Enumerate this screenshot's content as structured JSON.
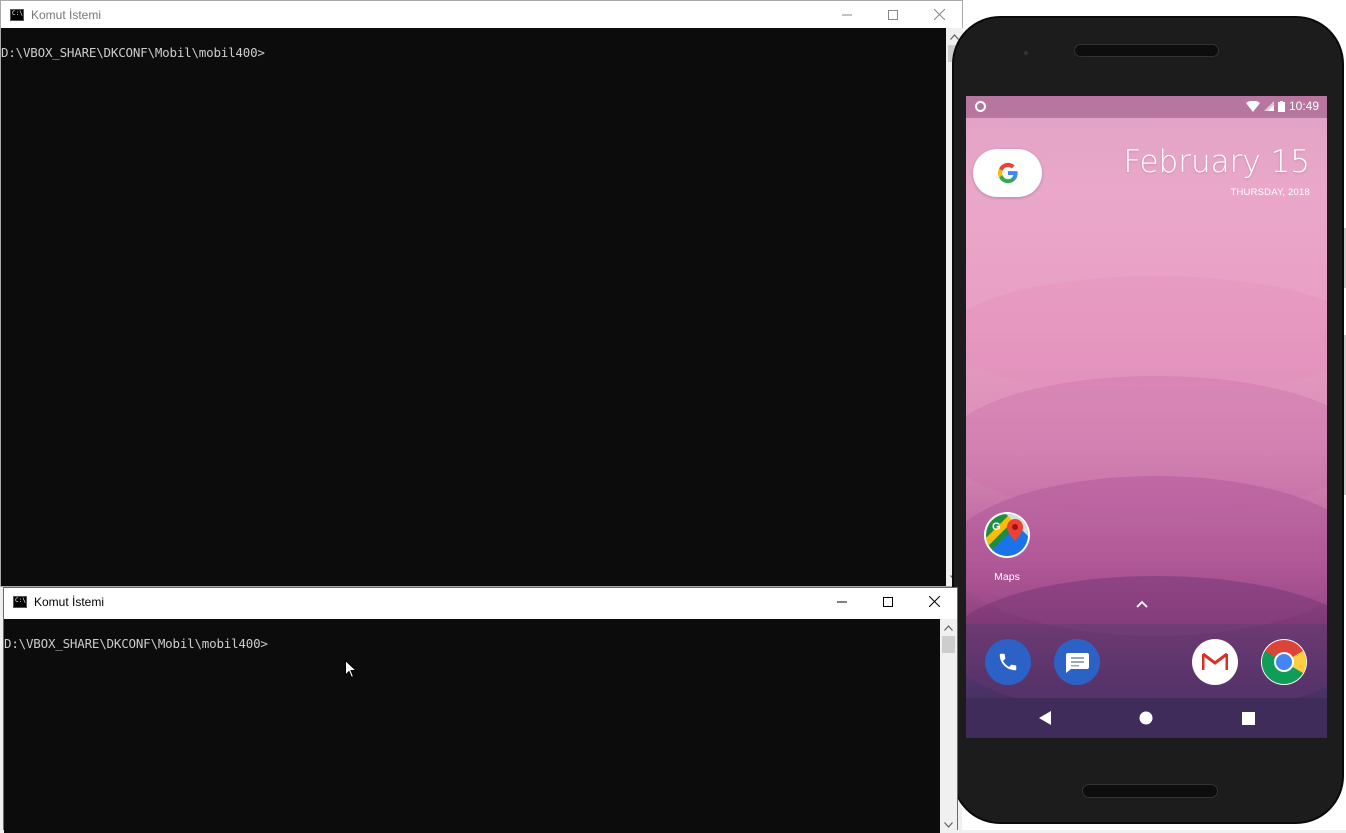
{
  "top_window": {
    "title": "Komut İstemi",
    "prompt": "D:\\VBOX_SHARE\\DKCONF\\Mobil\\mobil400>"
  },
  "bottom_window": {
    "title": "Komut İstemi",
    "prompt": "D:\\VBOX_SHARE\\DKCONF\\Mobil\\mobil400>"
  },
  "phone": {
    "status": {
      "time": "10:49"
    },
    "date": {
      "main": "February 15",
      "sub": "THURSDAY, 2018"
    },
    "apps": [
      {
        "label": "Maps"
      }
    ],
    "dock": [
      "phone-app",
      "messages-app",
      "gmail-app",
      "chrome-app"
    ]
  }
}
